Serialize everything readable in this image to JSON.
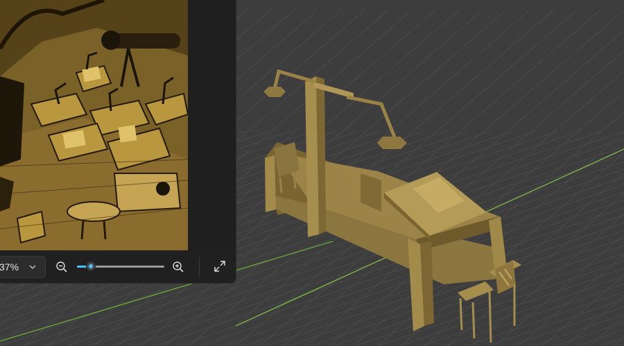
{
  "viewport": {
    "background_color": "#3d3d3d",
    "grid_color": "#4a4a4a",
    "x_axis_color": "#8ac04a",
    "y_axis_color": "#6aa63a",
    "model_color": "#a8904a",
    "model_name": "desk-with-lamps-model"
  },
  "reference_panel": {
    "image_subject": "sepia-illustration-classroom",
    "zoom_value": "37%",
    "zoom_fraction": 0.16,
    "icons": {
      "dropdown": "chevron-down-icon",
      "zoom_out": "zoom-out-icon",
      "zoom_in": "zoom-in-icon",
      "fit": "expand-icon"
    },
    "accent_color": "#4cc2ff"
  }
}
